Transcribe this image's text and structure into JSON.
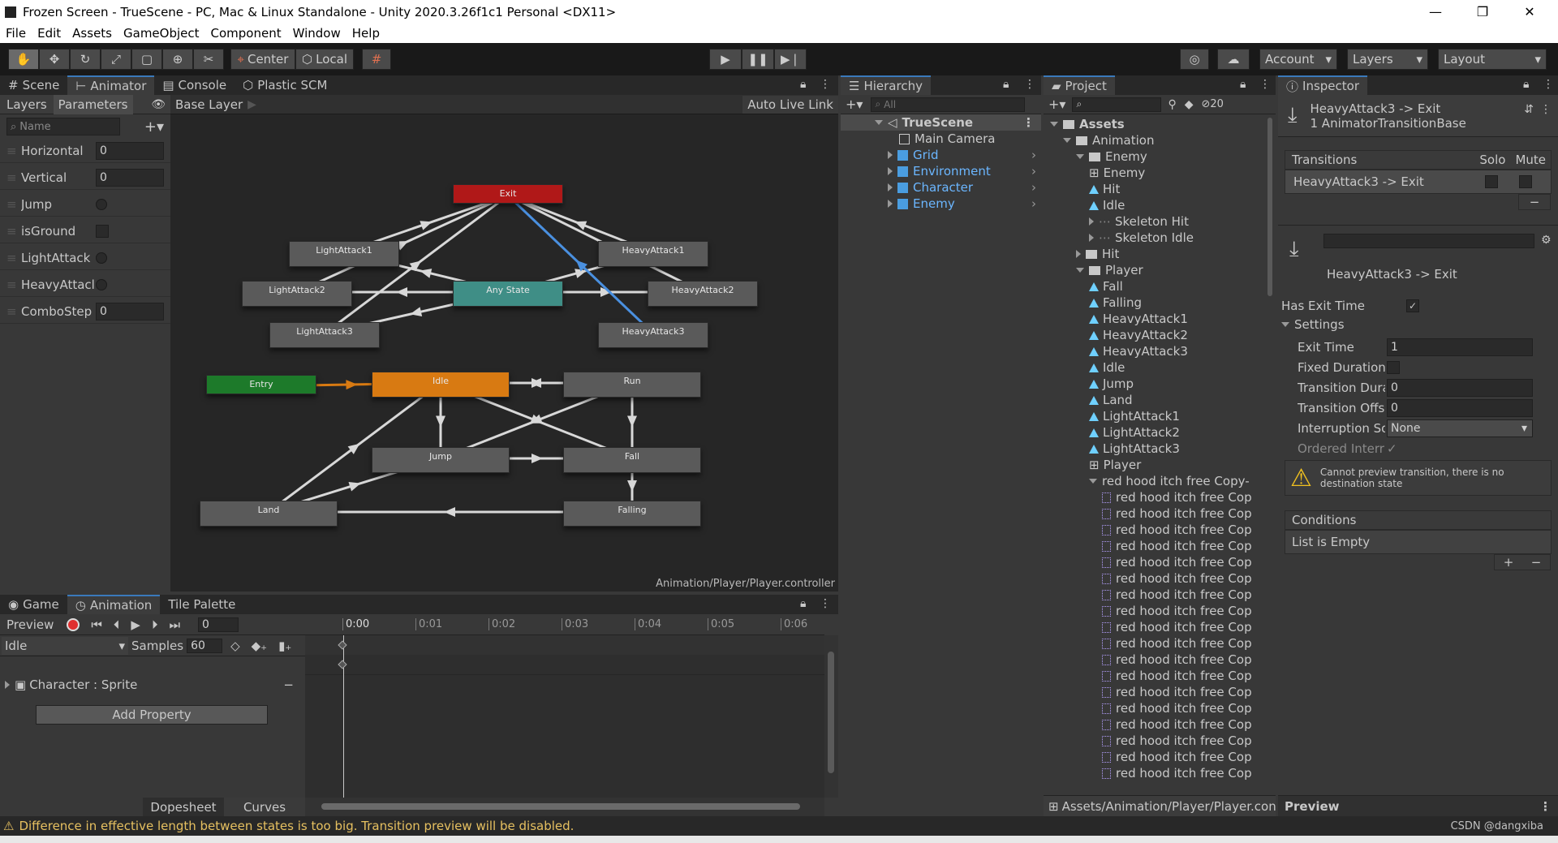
{
  "window": {
    "title": "Frozen Screen - TrueScene - PC, Mac & Linux Standalone - Unity 2020.3.26f1c1 Personal <DX11>",
    "minimize": "—",
    "maximize": "❐",
    "close": "✕"
  },
  "menu": [
    "File",
    "Edit",
    "Assets",
    "GameObject",
    "Component",
    "Window",
    "Help"
  ],
  "toolbar": {
    "pivot": "Center",
    "space": "Local",
    "account": "Account",
    "layers": "Layers",
    "layout": "Layout"
  },
  "tabs_top": [
    "Scene",
    "Animator",
    "Console",
    "Plastic SCM"
  ],
  "animator": {
    "subtabs": [
      "Layers",
      "Parameters"
    ],
    "layer": "Base Layer",
    "auto_live": "Auto Live Link",
    "search_placeholder": "Name",
    "params": [
      {
        "name": "Horizontal",
        "type": "float",
        "value": "0"
      },
      {
        "name": "Vertical",
        "type": "float",
        "value": "0"
      },
      {
        "name": "Jump",
        "type": "trigger",
        "value": ""
      },
      {
        "name": "isGround",
        "type": "bool",
        "value": ""
      },
      {
        "name": "LightAttack",
        "type": "trigger",
        "value": ""
      },
      {
        "name": "HeavyAttacl",
        "type": "trigger",
        "value": ""
      },
      {
        "name": "ComboStep",
        "type": "int",
        "value": "0"
      }
    ],
    "states": {
      "exit": "Exit",
      "la1": "LightAttack1",
      "ha1": "HeavyAttack1",
      "la2": "LightAttack2",
      "any": "Any State",
      "ha2": "HeavyAttack2",
      "la3": "LightAttack3",
      "ha3": "HeavyAttack3",
      "entry": "Entry",
      "idle": "Idle",
      "run": "Run",
      "jump": "Jump",
      "fall": "Fall",
      "land": "Land",
      "falling": "Falling"
    },
    "path": "Animation/Player/Player.controller",
    "colors": {
      "exit": "#b01818",
      "any": "#3f8e86",
      "entry": "#1d7a2a",
      "idle": "#d87a12",
      "default": "#5a5a5a",
      "selected_transition": "#4a90e0"
    }
  },
  "hierarchy": {
    "tab": "Hierarchy",
    "search": "All",
    "scene": "TrueScene",
    "items": [
      "Main Camera",
      "Grid",
      "Environment",
      "Character",
      "Enemy"
    ]
  },
  "project": {
    "tab": "Project",
    "count": "20",
    "tree": [
      {
        "label": "Assets",
        "depth": 0,
        "icon": "folder",
        "open": true
      },
      {
        "label": "Animation",
        "depth": 1,
        "icon": "folder",
        "open": true
      },
      {
        "label": "Enemy",
        "depth": 2,
        "icon": "folder",
        "open": true
      },
      {
        "label": "Enemy",
        "depth": 3,
        "icon": "controller"
      },
      {
        "label": "Hit",
        "depth": 3,
        "icon": "anim"
      },
      {
        "label": "Idle",
        "depth": 3,
        "icon": "anim"
      },
      {
        "label": "Skeleton Hit",
        "depth": 3,
        "icon": "closed"
      },
      {
        "label": "Skeleton Idle",
        "depth": 3,
        "icon": "closed"
      },
      {
        "label": "Hit",
        "depth": 2,
        "icon": "folder"
      },
      {
        "label": "Player",
        "depth": 2,
        "icon": "folder",
        "open": true
      },
      {
        "label": "Fall",
        "depth": 3,
        "icon": "anim"
      },
      {
        "label": "Falling",
        "depth": 3,
        "icon": "anim"
      },
      {
        "label": "HeavyAttack1",
        "depth": 3,
        "icon": "anim"
      },
      {
        "label": "HeavyAttack2",
        "depth": 3,
        "icon": "anim"
      },
      {
        "label": "HeavyAttack3",
        "depth": 3,
        "icon": "anim"
      },
      {
        "label": "Idle",
        "depth": 3,
        "icon": "anim"
      },
      {
        "label": "Jump",
        "depth": 3,
        "icon": "anim"
      },
      {
        "label": "Land",
        "depth": 3,
        "icon": "anim"
      },
      {
        "label": "LightAttack1",
        "depth": 3,
        "icon": "anim"
      },
      {
        "label": "LightAttack2",
        "depth": 3,
        "icon": "anim"
      },
      {
        "label": "LightAttack3",
        "depth": 3,
        "icon": "anim"
      },
      {
        "label": "Player",
        "depth": 3,
        "icon": "controller"
      },
      {
        "label": "red hood itch free Copy-",
        "depth": 3,
        "icon": "open"
      },
      {
        "label": "red hood itch free Cop",
        "depth": 4,
        "icon": "frame"
      },
      {
        "label": "red hood itch free Cop",
        "depth": 4,
        "icon": "frame"
      },
      {
        "label": "red hood itch free Cop",
        "depth": 4,
        "icon": "frame"
      },
      {
        "label": "red hood itch free Cop",
        "depth": 4,
        "icon": "frame"
      },
      {
        "label": "red hood itch free Cop",
        "depth": 4,
        "icon": "frame"
      },
      {
        "label": "red hood itch free Cop",
        "depth": 4,
        "icon": "frame"
      },
      {
        "label": "red hood itch free Cop",
        "depth": 4,
        "icon": "frame"
      },
      {
        "label": "red hood itch free Cop",
        "depth": 4,
        "icon": "frame"
      },
      {
        "label": "red hood itch free Cop",
        "depth": 4,
        "icon": "frame"
      },
      {
        "label": "red hood itch free Cop",
        "depth": 4,
        "icon": "frame"
      },
      {
        "label": "red hood itch free Cop",
        "depth": 4,
        "icon": "frame"
      },
      {
        "label": "red hood itch free Cop",
        "depth": 4,
        "icon": "frame"
      },
      {
        "label": "red hood itch free Cop",
        "depth": 4,
        "icon": "frame"
      },
      {
        "label": "red hood itch free Cop",
        "depth": 4,
        "icon": "frame"
      },
      {
        "label": "red hood itch free Cop",
        "depth": 4,
        "icon": "frame"
      },
      {
        "label": "red hood itch free Cop",
        "depth": 4,
        "icon": "frame"
      },
      {
        "label": "red hood itch free Cop",
        "depth": 4,
        "icon": "frame"
      },
      {
        "label": "red hood itch free Cop",
        "depth": 4,
        "icon": "frame"
      }
    ],
    "footer": "Assets/Animation/Player/Player.con"
  },
  "inspector": {
    "tab": "Inspector",
    "title": "HeavyAttack3 -> Exit",
    "subtitle": "1 AnimatorTransitionBase",
    "transitions_header": "Transitions",
    "solo": "Solo",
    "mute": "Mute",
    "transition_item": "HeavyAttack3 -> Exit",
    "minus": "−",
    "transition_name": "HeavyAttack3 -> Exit",
    "has_exit_time": "Has Exit Time",
    "settings": "Settings",
    "fields": [
      {
        "label": "Exit Time",
        "value": "1"
      },
      {
        "label": "Fixed Duration",
        "value": ""
      },
      {
        "label": "Transition Duratio",
        "value": "0"
      },
      {
        "label": "Transition Offset",
        "value": "0"
      },
      {
        "label": "Interruption Sourc",
        "value": "None"
      },
      {
        "label": "Ordered Interruptic",
        "value": "✓"
      }
    ],
    "warning": "Cannot preview transition, there is no destination state",
    "conditions": "Conditions",
    "list_empty": "List is Empty",
    "plus": "+",
    "preview": "Preview"
  },
  "bottom": {
    "tabs": [
      "Game",
      "Animation",
      "Tile Palette"
    ],
    "preview": "Preview",
    "frame": "0",
    "clip": "Idle",
    "samples_label": "Samples",
    "samples": "60",
    "property": "Character : Sprite",
    "add_property": "Add Property",
    "ruler": [
      "0:00",
      "0:01",
      "0:02",
      "0:03",
      "0:04",
      "0:05",
      "0:06"
    ],
    "dopesheet": "Dopesheet",
    "curves": "Curves"
  },
  "status": {
    "message": "Difference in effective length between states is too big. Transition preview will be disabled.",
    "watermark": "CSDN @dangxiba"
  }
}
